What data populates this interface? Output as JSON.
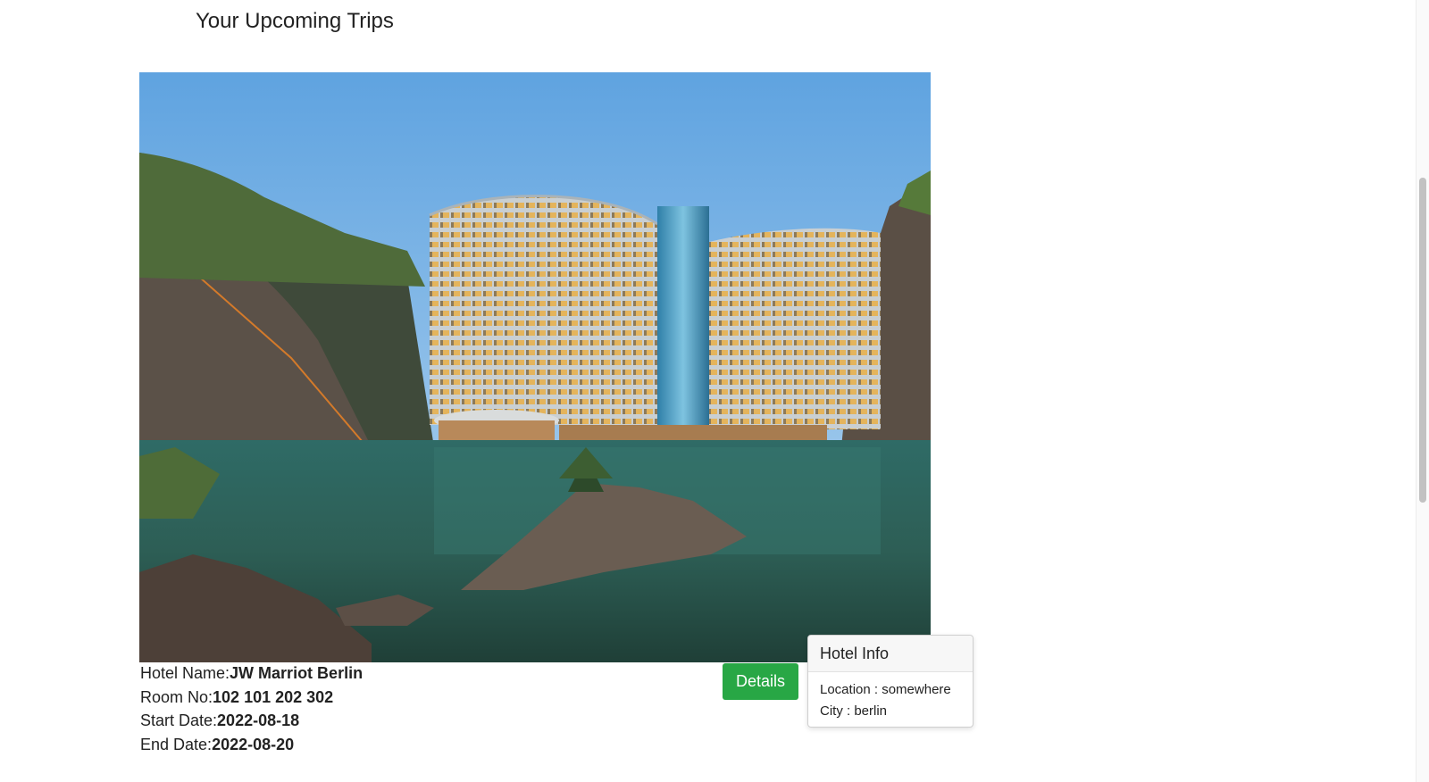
{
  "page": {
    "title": "Your Upcoming Trips"
  },
  "trip": {
    "hotel_name_label": "Hotel Name:",
    "hotel_name_value": "JW Marriot Berlin",
    "room_label": "Room No:",
    "room_value": "102 101 202 302",
    "start_label": "Start Date:",
    "start_value": "2022-08-18",
    "end_label": "End Date:",
    "end_value": "2022-08-20",
    "photo_alt": "hotel photo",
    "details_button": "Details"
  },
  "popover": {
    "title": "Hotel Info",
    "location_line": "Location : somewhere",
    "city_line": "City : berlin"
  },
  "colors": {
    "details_button": "#28a745"
  }
}
